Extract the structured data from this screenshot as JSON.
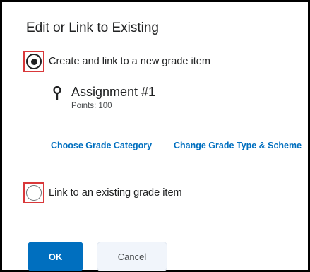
{
  "dialog": {
    "title": "Edit or Link to Existing"
  },
  "options": {
    "create_new": {
      "label": "Create and link to a new grade item",
      "selected": true
    },
    "link_existing": {
      "label": "Link to an existing grade item",
      "selected": false
    }
  },
  "grade_item": {
    "icon": "pin-icon",
    "name": "Assignment #1",
    "points": "Points: 100"
  },
  "links": {
    "choose_category": "Choose Grade Category",
    "change_type": "Change Grade Type & Scheme"
  },
  "buttons": {
    "ok": "OK",
    "cancel": "Cancel"
  },
  "colors": {
    "accent": "#006fbf",
    "highlight_box": "#d9383a",
    "text": "#202122"
  }
}
